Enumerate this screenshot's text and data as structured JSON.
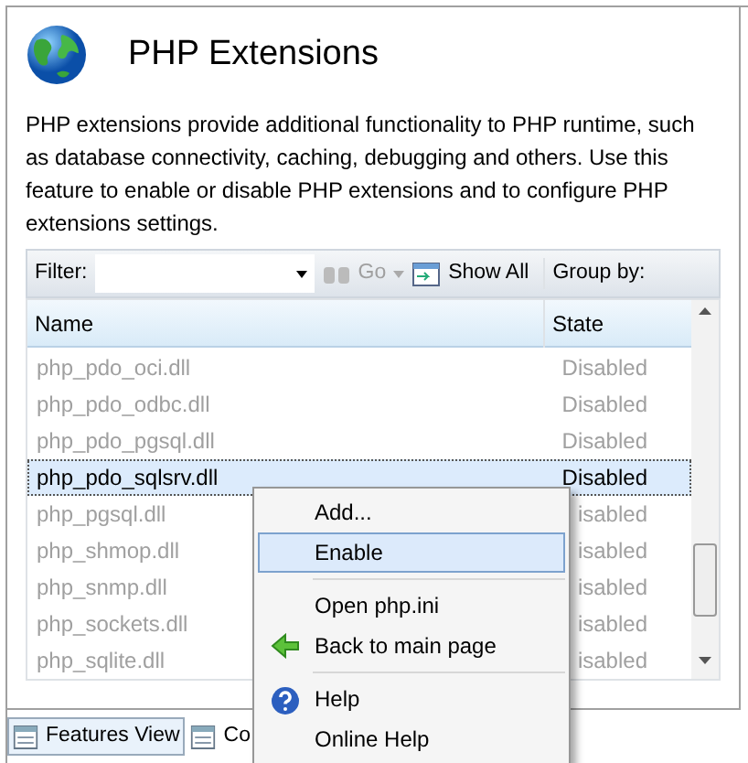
{
  "header": {
    "title": "PHP Extensions",
    "description": "PHP extensions provide additional functionality to PHP runtime, such as database connectivity, caching, debugging and others. Use this feature to enable or disable PHP extensions and to configure PHP extensions settings."
  },
  "toolbar": {
    "filter_label": "Filter:",
    "go": "Go",
    "show_all": "Show All",
    "group_by": "Group by:"
  },
  "table": {
    "columns": [
      "Name",
      "State"
    ],
    "rows": [
      {
        "name": "php_pdo_oci.dll",
        "state": "Disabled",
        "selected": false
      },
      {
        "name": "php_pdo_odbc.dll",
        "state": "Disabled",
        "selected": false
      },
      {
        "name": "php_pdo_pgsql.dll",
        "state": "Disabled",
        "selected": false
      },
      {
        "name": "php_pdo_sqlsrv.dll",
        "state": "Disabled",
        "selected": true
      },
      {
        "name": "php_pgsql.dll",
        "state": "isabled",
        "selected": false
      },
      {
        "name": "php_shmop.dll",
        "state": "isabled",
        "selected": false
      },
      {
        "name": "php_snmp.dll",
        "state": "isabled",
        "selected": false
      },
      {
        "name": "php_sockets.dll",
        "state": "isabled",
        "selected": false
      },
      {
        "name": "php_sqlite.dll",
        "state": "isabled",
        "selected": false
      }
    ]
  },
  "context_menu": [
    {
      "kind": "command",
      "label": "Add...",
      "selected": false
    },
    {
      "kind": "command",
      "label": "Enable",
      "selected": true
    },
    {
      "kind": "separator"
    },
    {
      "kind": "command",
      "label": "Open php.ini",
      "selected": false
    },
    {
      "kind": "back",
      "label": "Back to main page",
      "selected": false
    },
    {
      "kind": "separator"
    },
    {
      "kind": "help",
      "label": "Help",
      "selected": false
    },
    {
      "kind": "command",
      "label": "Online Help",
      "selected": false
    }
  ],
  "view_tabs": [
    {
      "label": "Features View",
      "selected": true
    },
    {
      "label": "Co",
      "selected": false
    }
  ]
}
